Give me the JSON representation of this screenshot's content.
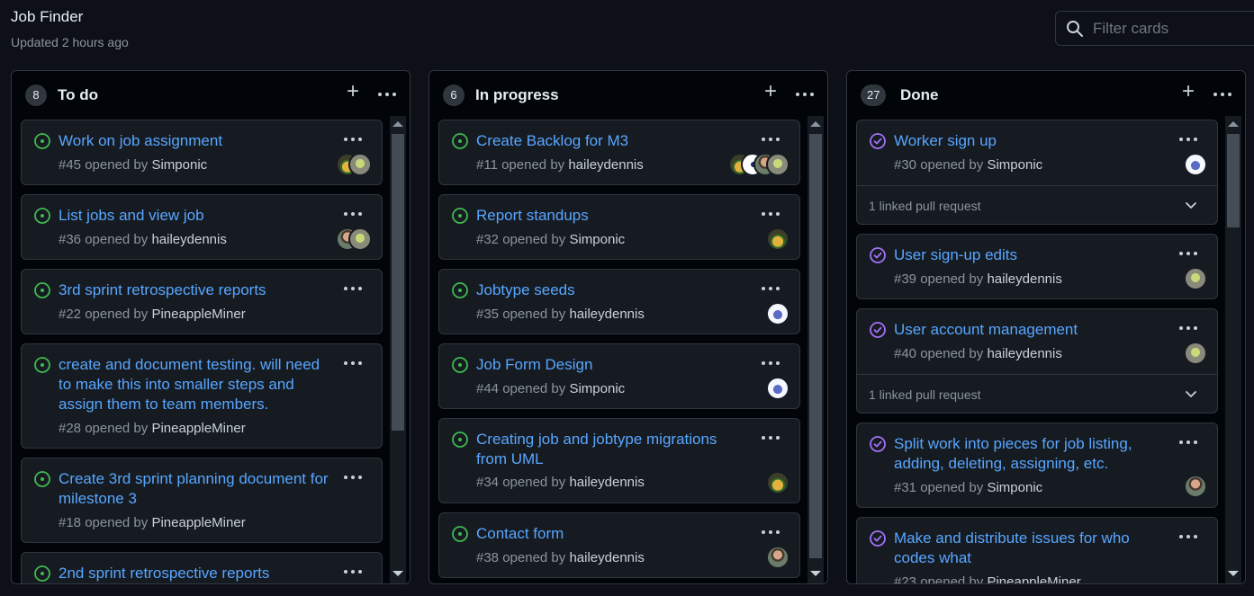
{
  "header": {
    "title": "Job Finder",
    "updated": "Updated 2 hours ago",
    "filter_placeholder": "Filter cards"
  },
  "colors": {
    "open": "#3fb950",
    "closed": "#a371f7",
    "link": "#58a6ff"
  },
  "columns": [
    {
      "name": "To do",
      "count": "8",
      "cards": [
        {
          "title": "Work on job assignment",
          "number": "#45",
          "opened_by": "opened by",
          "author": "Simponic"
        },
        {
          "title": "List jobs and view job",
          "number": "#36",
          "opened_by": "opened by",
          "author": "haileydennis"
        },
        {
          "title": "3rd sprint retrospective reports",
          "number": "#22",
          "opened_by": "opened by",
          "author": "PineappleMiner"
        },
        {
          "title": "create and document testing. will need to make this into smaller steps and assign them to team members.",
          "number": "#28",
          "opened_by": "opened by",
          "author": "PineappleMiner"
        },
        {
          "title": "Create 3rd sprint planning document for milestone 3",
          "number": "#18",
          "opened_by": "opened by",
          "author": "PineappleMiner"
        },
        {
          "title": "2nd sprint retrospective reports",
          "number": "",
          "opened_by": "",
          "author": ""
        }
      ]
    },
    {
      "name": "In progress",
      "count": "6",
      "cards": [
        {
          "title": "Create Backlog for M3",
          "number": "#11",
          "opened_by": "opened by",
          "author": "haileydennis"
        },
        {
          "title": "Report standups",
          "number": "#32",
          "opened_by": "opened by",
          "author": "Simponic"
        },
        {
          "title": "Jobtype seeds",
          "number": "#35",
          "opened_by": "opened by",
          "author": "haileydennis"
        },
        {
          "title": "Job Form Design",
          "number": "#44",
          "opened_by": "opened by",
          "author": "Simponic"
        },
        {
          "title": "Creating job and jobtype migrations from UML",
          "number": "#34",
          "opened_by": "opened by",
          "author": "haileydennis"
        },
        {
          "title": "Contact form",
          "number": "#38",
          "opened_by": "opened by",
          "author": "haileydennis"
        }
      ]
    },
    {
      "name": "Done",
      "count": "27",
      "cards": [
        {
          "title": "Worker sign up",
          "number": "#30",
          "opened_by": "opened by",
          "author": "Simponic",
          "linked": "1 linked pull request"
        },
        {
          "title": "User sign-up edits",
          "number": "#39",
          "opened_by": "opened by",
          "author": "haileydennis"
        },
        {
          "title": "User account management",
          "number": "#40",
          "opened_by": "opened by",
          "author": "haileydennis",
          "linked": "1 linked pull request"
        },
        {
          "title": "Split work into pieces for job listing, adding, deleting, assigning, etc.",
          "number": "#31",
          "opened_by": "opened by",
          "author": "Simponic"
        },
        {
          "title": "Make and distribute issues for who codes what",
          "number": "#23",
          "opened_by": "opened by",
          "author": "PineappleMiner"
        }
      ]
    }
  ]
}
